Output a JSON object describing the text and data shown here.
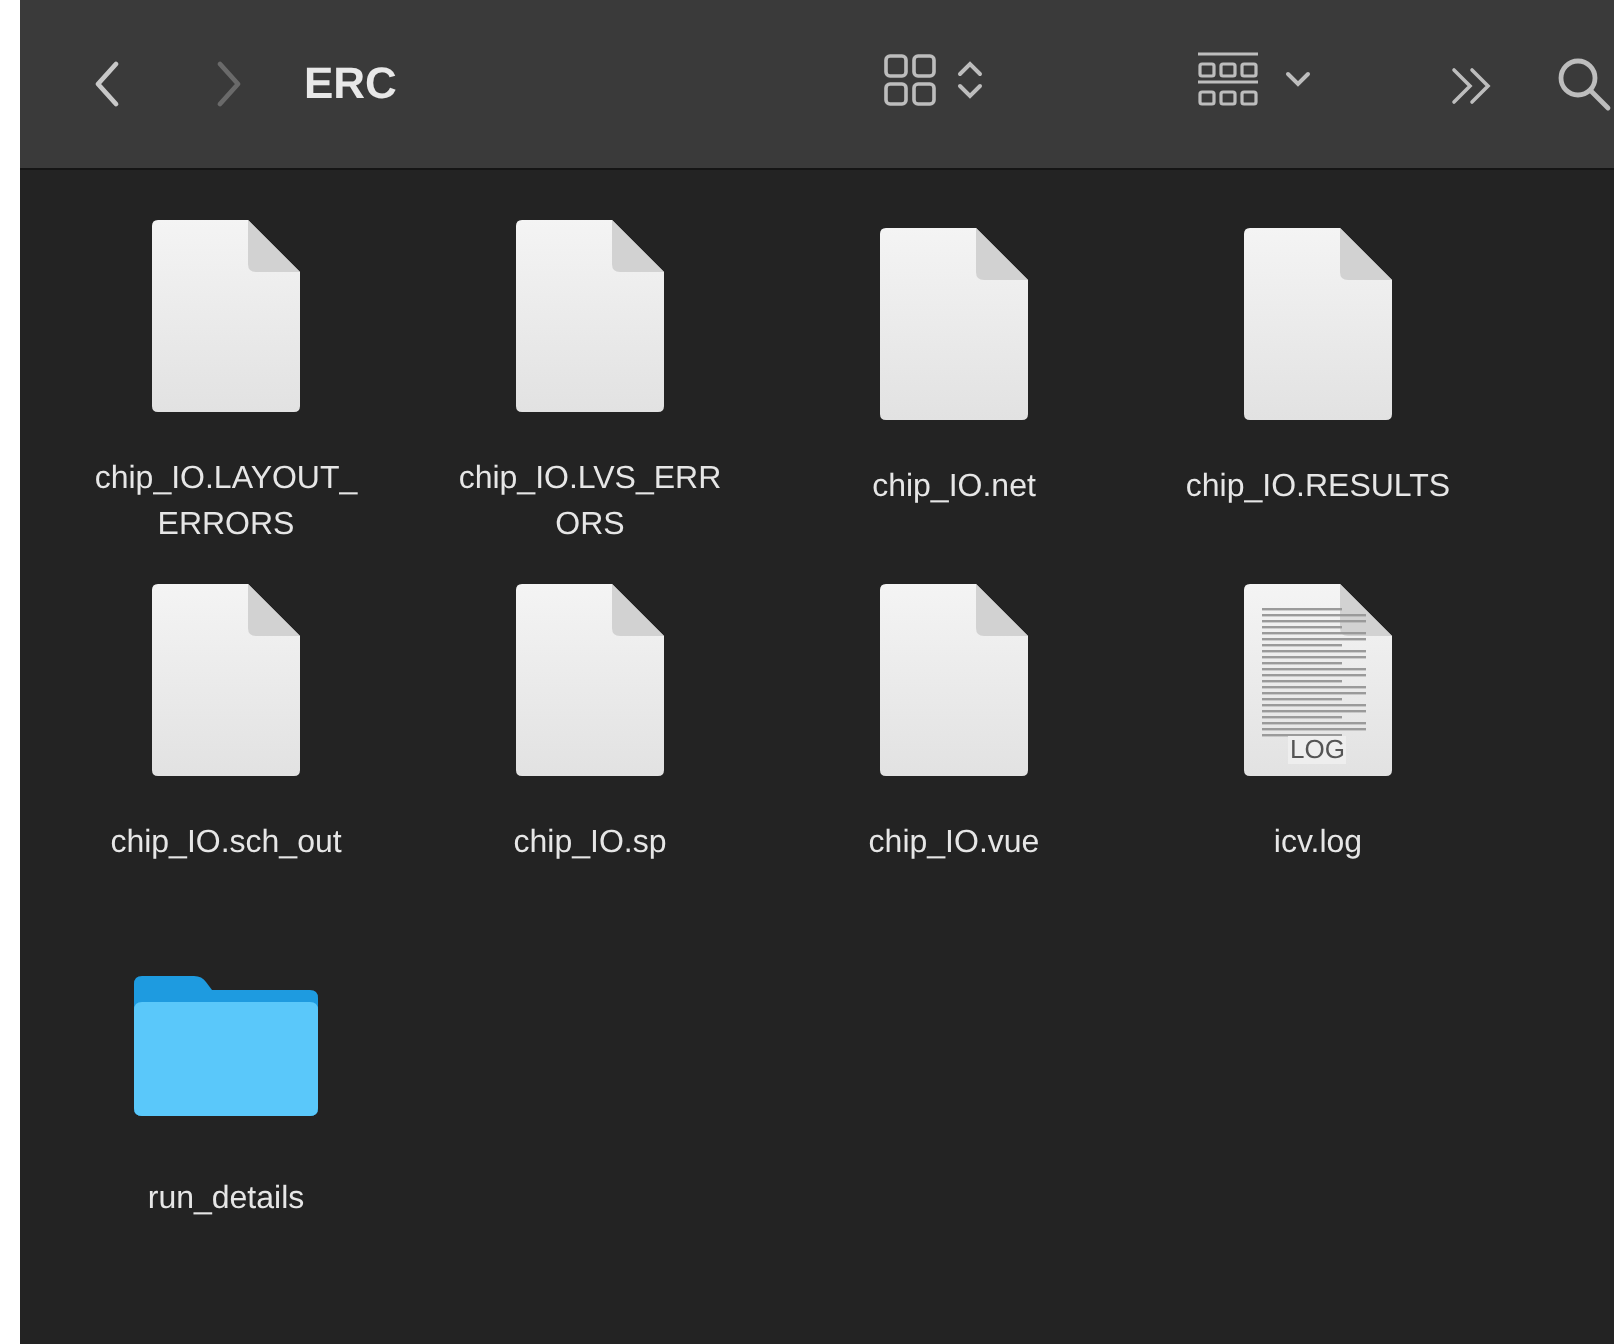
{
  "toolbar": {
    "back": {
      "disabled": false
    },
    "forward": {
      "disabled": true
    },
    "title": "ERC"
  },
  "files": [
    {
      "kind": "document",
      "label_lines": [
        "chip_IO.LAYOUT_",
        "ERRORS"
      ]
    },
    {
      "kind": "document",
      "label_lines": [
        "chip_IO.LVS_ERR",
        "ORS"
      ]
    },
    {
      "kind": "document",
      "label_lines": [
        "chip_IO.net"
      ]
    },
    {
      "kind": "document",
      "label_lines": [
        "chip_IO.RESULTS"
      ]
    },
    {
      "kind": "document",
      "label_lines": [
        "chip_IO.sch_out"
      ]
    },
    {
      "kind": "document",
      "label_lines": [
        "chip_IO.sp"
      ]
    },
    {
      "kind": "document",
      "label_lines": [
        "chip_IO.vue"
      ]
    },
    {
      "kind": "log",
      "badge": "LOG",
      "label_lines": [
        "icv.log"
      ]
    },
    {
      "kind": "folder",
      "label_lines": [
        "run_details"
      ]
    }
  ]
}
